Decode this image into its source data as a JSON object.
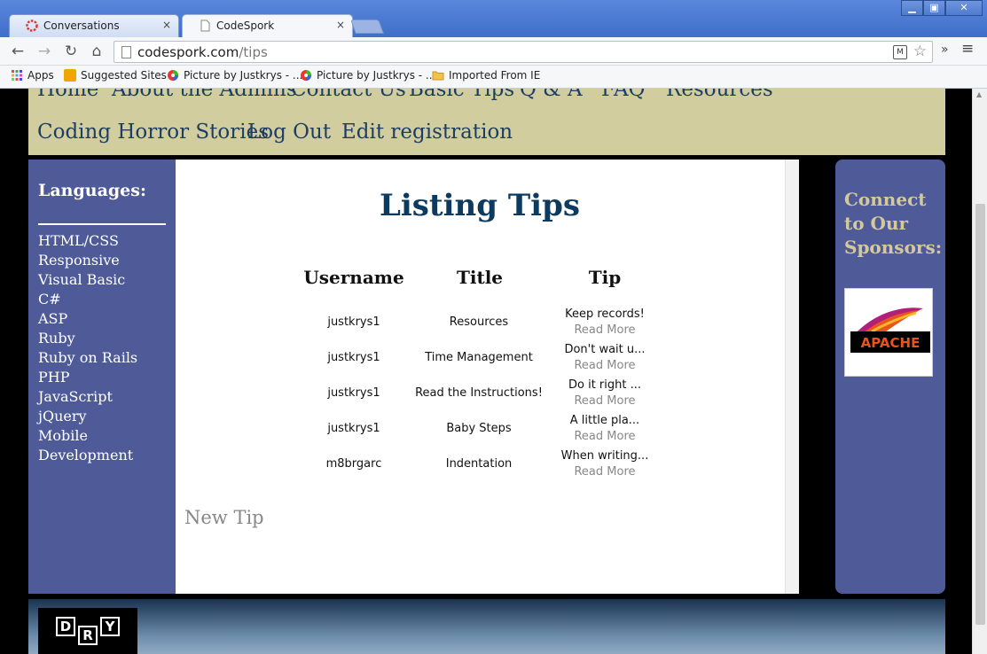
{
  "browser": {
    "tabs": [
      {
        "title": "Conversations",
        "close": "×",
        "favicon_color": "#d9362b"
      },
      {
        "title": "CodeSpork",
        "close": "×",
        "favicon_color": "#ffffff"
      }
    ],
    "window_controls": {
      "minimize": "▁",
      "maximize": "▣",
      "close": "✕"
    },
    "url": {
      "domain": "codespork.com",
      "path": "/tips"
    },
    "toolbar_right": {
      "overflow": "»",
      "menu": "≡"
    },
    "bookmarks": [
      {
        "label": "Apps",
        "icon": "apps-grid-icon"
      },
      {
        "label": "Suggested Sites",
        "icon": "suggested-sites-icon"
      },
      {
        "label": "Picture by Justkrys - ...",
        "icon": "picasa-icon"
      },
      {
        "label": "Picture by Justkrys - ...",
        "icon": "picasa-icon"
      },
      {
        "label": "Imported From IE",
        "icon": "folder-icon"
      }
    ]
  },
  "nav": {
    "row1": [
      "Home",
      "About the Admins",
      "Contact Us",
      "Basic Tips",
      "Q & A",
      "FAQ",
      "Resources"
    ],
    "row2": [
      "Coding Horror Stories",
      "Log Out",
      "Edit registration"
    ]
  },
  "sidebar": {
    "heading": "Languages:",
    "items": [
      "HTML/CSS",
      "Responsive",
      "Visual Basic",
      "C#",
      "ASP",
      "Ruby",
      "Ruby on Rails",
      "PHP",
      "JavaScript",
      "jQuery",
      "Mobile",
      "Development"
    ]
  },
  "main": {
    "title": "Listing Tips",
    "columns": [
      "Username",
      "Title",
      "Tip"
    ],
    "rows": [
      {
        "username": "justkrys1",
        "title": "Resources",
        "tip": "Keep records!",
        "more": "Read More"
      },
      {
        "username": "justkrys1",
        "title": "Time Management",
        "tip": "Don't wait u...",
        "more": "Read More"
      },
      {
        "username": "justkrys1",
        "title": "Read the Instructions!",
        "tip": "Do it right ...",
        "more": "Read More"
      },
      {
        "username": "justkrys1",
        "title": "Baby Steps",
        "tip": "A little pla...",
        "more": "Read More"
      },
      {
        "username": "m8brgarc",
        "title": "Indentation",
        "tip": "When writing...",
        "more": "Read More"
      }
    ],
    "new_tip": "New Tip"
  },
  "sponsors": {
    "heading": "Connect to Our Sponsors:",
    "logo": {
      "text": "APACHE",
      "icon": "apache-feather-icon"
    }
  },
  "footer": {
    "logo_letters": [
      "D",
      "R",
      "Y"
    ]
  },
  "colors": {
    "nav_bg": "#d1cd9f",
    "sidebar_bg": "#4e5b98",
    "title_blue": "#0d3a5f",
    "sponsor_gold": "#d4c99b"
  }
}
